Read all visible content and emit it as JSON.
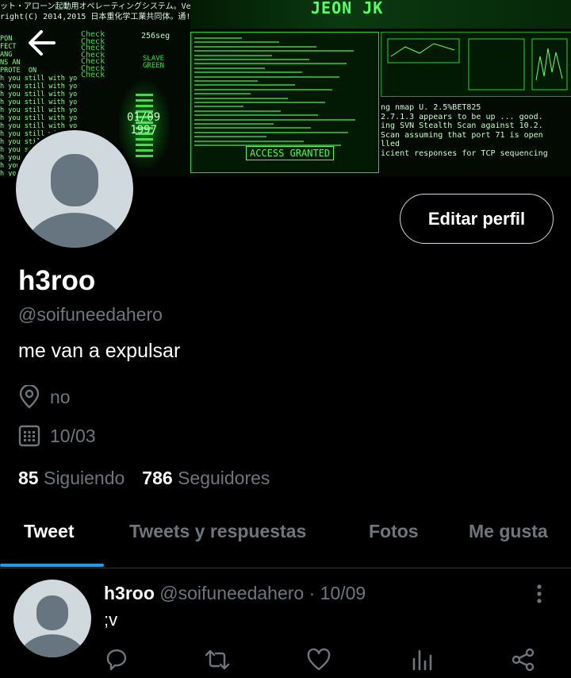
{
  "banner": {
    "jp_lines": [
      "ット・アローン起動用オペレーティングシステム。Ve",
      "right(C) 2014,2015 日本重化学工業共同体。通!"
    ],
    "left_lines": [
      "PON",
      "FECT",
      "ANG",
      "NS AN",
      "PROTE  ON",
      "h you still with you still with you",
      "h you still with you still with you",
      "h you still with you still with you",
      "h you still with you still with you",
      "h you still with you still with you",
      "h you still with you still with you",
      "h you still with you still with you",
      "h you still with you still with you",
      "h you still with you still with you",
      "h you still with you still with you",
      "h you still with you still with you",
      "h you",
      "h you",
      "h you"
    ],
    "check_lines": [
      "Check",
      "Check",
      "Check",
      "Check",
      "Check",
      "Check",
      "Check"
    ],
    "timer": "256seg",
    "slave_lines": [
      "SLAVE",
      "GREEN"
    ],
    "date_lines": [
      "01/09",
      "1997"
    ],
    "watermark": "JEON JK",
    "access": "ACCESS GRANTED",
    "scan_lines": [
      "ng nmap U. 2.5%BET825",
      "2.7.1.3 appears to be up ... good.",
      "ing SVN Stealth Scan against 10.2.",
      "Scan assuming that port 71 is open",
      "lled",
      "icient responses for TCP sequencing"
    ]
  },
  "profile": {
    "edit_label": "Editar perfil",
    "name": "h3roo",
    "handle": "@soifuneedahero",
    "bio": "me van a expulsar",
    "location": "no",
    "date": "10/03",
    "following_count": "85",
    "following_label": "Siguiendo",
    "followers_count": "786",
    "followers_label": "Seguidores"
  },
  "tabs": [
    {
      "label": "Tweet",
      "active": true
    },
    {
      "label": "Tweets y respuestas",
      "active": false
    },
    {
      "label": "Fotos",
      "active": false
    },
    {
      "label": "Me gusta",
      "active": false
    }
  ],
  "tweet": {
    "name": "h3roo",
    "handle": "@soifuneedahero",
    "sep": "·",
    "date": "10/09",
    "text": ";v"
  },
  "icons": {
    "back": "arrow-left-icon",
    "location": "location-pin-icon",
    "calendar": "calendar-icon",
    "more": "more-vertical-icon",
    "reply": "reply-icon",
    "retweet": "retweet-icon",
    "like": "heart-icon",
    "stats": "stats-icon",
    "share": "share-icon"
  },
  "colors": {
    "accent": "#1d9bf0",
    "muted": "#6e767d",
    "banner_green": "#3be23b"
  }
}
